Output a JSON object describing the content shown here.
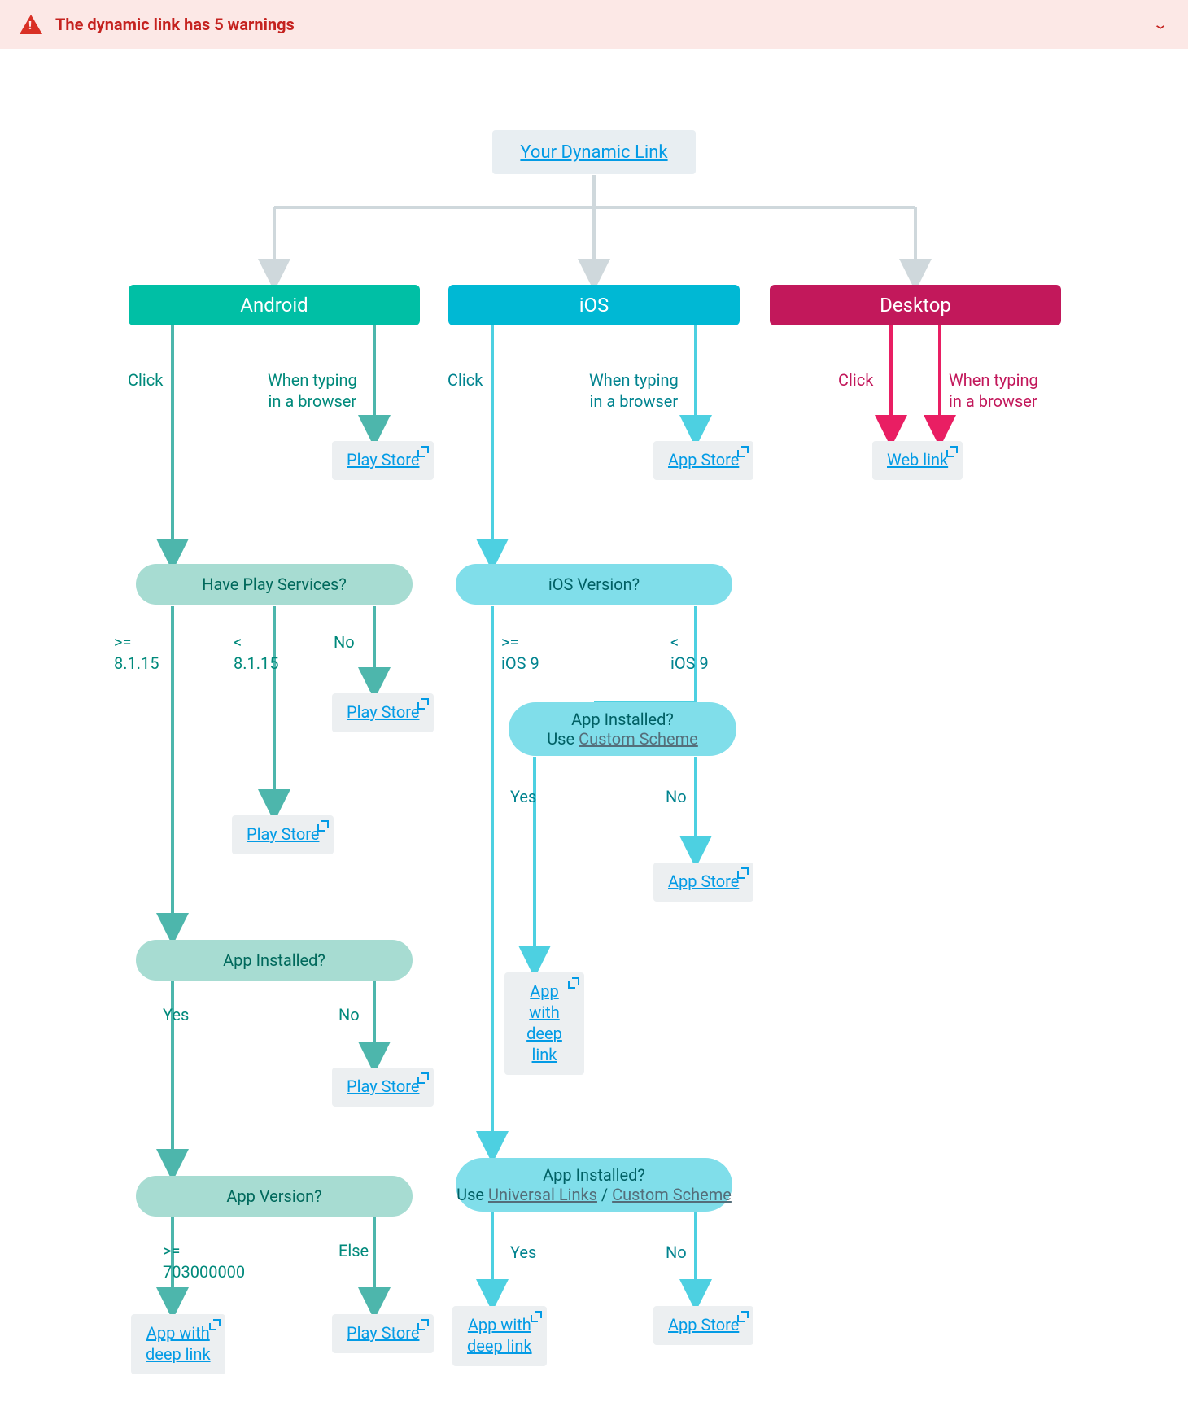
{
  "banner": {
    "text": "The dynamic link has 5 warnings"
  },
  "root": {
    "label": "Your Dynamic Link"
  },
  "platforms": {
    "android": "Android",
    "ios": "iOS",
    "desktop": "Desktop"
  },
  "edgeLabels": {
    "click": "Click",
    "typing": "When typing\nin a browser",
    "gte_8115": ">=\n8.1.15",
    "lt_8115": "<\n8.1.15",
    "no": "No",
    "yes": "Yes",
    "gte_ios9": ">=\niOS 9",
    "lt_ios9": "<\niOS 9",
    "else": "Else",
    "gte_v": ">=\n703000000"
  },
  "decisions": {
    "haveps": "Have Play Services?",
    "appInstalled": "App Installed?",
    "appVersion": "App Version?",
    "iosVersion": "iOS Version?",
    "appInstalledQ": "App Installed?",
    "useCustomScheme": "Use ",
    "customScheme": "Custom Scheme",
    "universalLinks": "Universal Links",
    "useULCS_pre": "Use ",
    "useULCS_sep": " / "
  },
  "endpoints": {
    "playStore": "Play Store",
    "appStore": "App Store",
    "webLink": "Web link",
    "appDeep1": "App with",
    "appDeep2": "deep link"
  }
}
